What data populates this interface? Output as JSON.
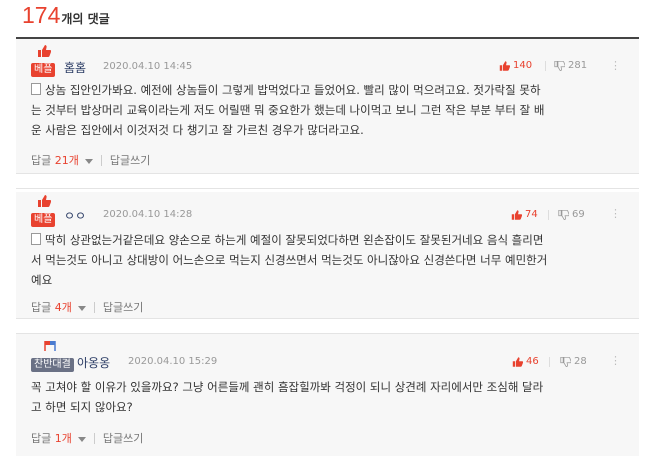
{
  "header": {
    "count": "174",
    "label": "개의 댓글"
  },
  "comments": [
    {
      "badge": "베플",
      "nick": "홈홈",
      "date": "2020.04.10 14:45",
      "up": "140",
      "down": "281",
      "lines": [
        "상놈 집안인가봐요. 예전에 상놈들이 그렇게 밥먹었다고 들었어요. 빨리 많이 먹으려고요. 젓가락질 못하",
        "는 것부터 밥상머리 교육이라는게 저도 어릴땐 뭐 중요한가 했는데 나이먹고 보니 그런 작은 부분 부터 잘 배",
        "운 사람은 집안에서 이것저것 다 챙기고 잘 가르친 경우가 많더라고요."
      ],
      "reply_label": "답글",
      "reply_count": "21개",
      "write_label": "답글쓰기"
    },
    {
      "badge": "베플",
      "nick": "ㅇㅇ",
      "date": "2020.04.10 14:28",
      "up": "74",
      "down": "69",
      "lines": [
        "딱히 상관없는거같은데요 양손으로 하는게 예절이 잘못되었다하면 왼손잡이도 잘못된거네요 음식 흘리면",
        "서 먹는것도 아니고 상대방이 어느손으로 먹는지 신경쓰면서 먹는것도 아니잖아요 신경쓴다면 너무 예민한거",
        "예요"
      ],
      "reply_label": "답글",
      "reply_count": "4개",
      "write_label": "답글쓰기"
    },
    {
      "badge": "찬반대결",
      "nick": "아옹옹",
      "date": "2020.04.10 15:29",
      "up": "46",
      "down": "28",
      "lines": [
        "꼭 고쳐야 할 이유가 있을까요? 그냥 어른들께 괜히 흠잡힐까봐 걱정이 되니 상견례 자리에서만 조심해 달라",
        "고 하면 되지 않아요?"
      ],
      "reply_label": "답글",
      "reply_count": "1개",
      "write_label": "답글쓰기"
    }
  ],
  "colors": {
    "accent": "#e8422f",
    "reply_badge": "#6a7185",
    "nick": "#2d3e66"
  }
}
